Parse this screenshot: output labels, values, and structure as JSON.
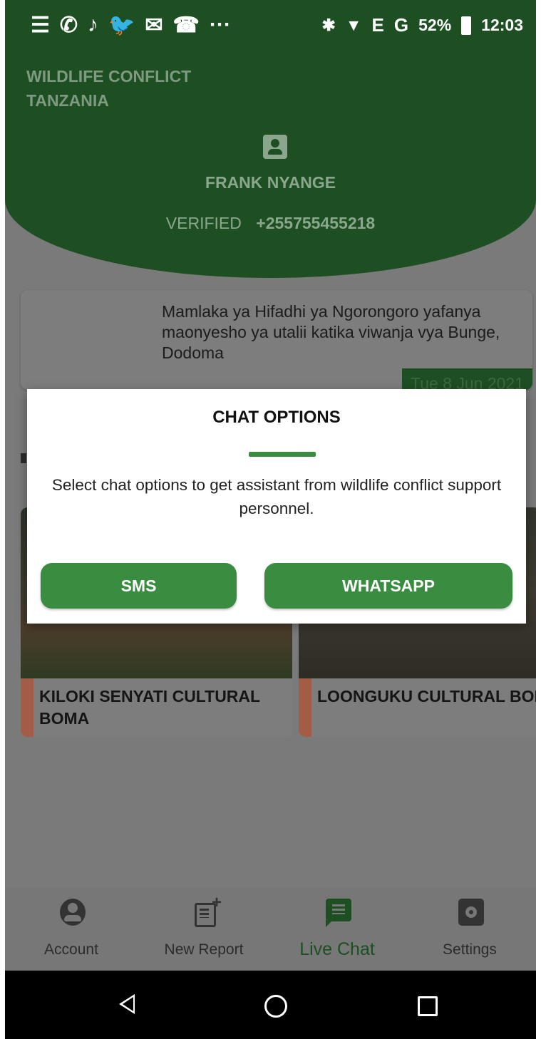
{
  "status_bar": {
    "notification_icons": [
      "☰",
      "✆",
      "♪",
      "🐦",
      "✉",
      "☎",
      "···"
    ],
    "bluetooth": "✱",
    "wifi": "▼",
    "network_1": "E",
    "network_2": "G",
    "battery": "52%",
    "time": "12:03"
  },
  "header": {
    "org_line1": "WILDLIFE CONFLICT",
    "org_line2": "TANZANIA",
    "user_name": "FRANK NYANGE",
    "verified_label": "VERIFIED",
    "phone": "+255755455218"
  },
  "news": {
    "text": "Mamlaka ya Hifadhi ya Ngorongoro yafanya maonyesho ya utalii katika viwanja vya Bunge, Dodoma",
    "date": "Tue 8 Jun 2021"
  },
  "bomas": [
    {
      "title": "KILOKI SENYATI CULTURAL\nBOMA"
    },
    {
      "title": "LOONGUKU CULTURAL BOMA"
    }
  ],
  "dialog": {
    "title": "CHAT OPTIONS",
    "message": "Select chat options to get assistant from wildlife conflict support personnel.",
    "sms_label": "SMS",
    "whatsapp_label": "WHATSAPP"
  },
  "bottom_nav": {
    "items": [
      {
        "label": "Account",
        "icon": "account-circle-icon"
      },
      {
        "label": "New Report",
        "icon": "note-add-icon"
      },
      {
        "label": "Live Chat",
        "icon": "chat-icon",
        "active": true
      },
      {
        "label": "Settings",
        "icon": "settings-icon"
      }
    ]
  },
  "colors": {
    "brand_green": "#3a8d40",
    "header_green": "#1d4f22",
    "accent_red": "#c2441c"
  }
}
